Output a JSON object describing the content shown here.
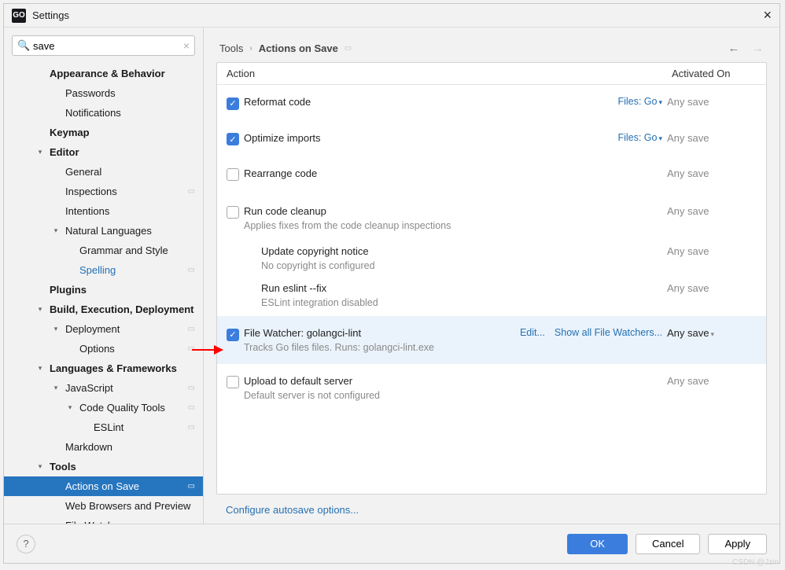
{
  "title": "Settings",
  "app_icon_text": "GO",
  "search": {
    "value": "save"
  },
  "sidebar": {
    "items": [
      {
        "label": "Appearance & Behavior",
        "level": 1,
        "bold": true,
        "chev": ""
      },
      {
        "label": "Passwords",
        "level": 2
      },
      {
        "label": "Notifications",
        "level": 2
      },
      {
        "label": "Keymap",
        "level": 1,
        "bold": true
      },
      {
        "label": "Editor",
        "level": 1,
        "bold": true,
        "chev": "▾"
      },
      {
        "label": "General",
        "level": 2
      },
      {
        "label": "Inspections",
        "level": 2,
        "gear": true
      },
      {
        "label": "Intentions",
        "level": 2
      },
      {
        "label": "Natural Languages",
        "level": 2,
        "chev": "▾"
      },
      {
        "label": "Grammar and Style",
        "level": 3
      },
      {
        "label": "Spelling",
        "level": 3,
        "link": true,
        "gear": true
      },
      {
        "label": "Plugins",
        "level": 1,
        "bold": true
      },
      {
        "label": "Build, Execution, Deployment",
        "level": 1,
        "bold": true,
        "chev": "▾"
      },
      {
        "label": "Deployment",
        "level": 2,
        "chev": "▾",
        "gear": true
      },
      {
        "label": "Options",
        "level": 3,
        "gear": true
      },
      {
        "label": "Languages & Frameworks",
        "level": 1,
        "bold": true,
        "chev": "▾"
      },
      {
        "label": "JavaScript",
        "level": 2,
        "chev": "▾",
        "gear": true
      },
      {
        "label": "Code Quality Tools",
        "level": 3,
        "chev": "▾",
        "gear": true
      },
      {
        "label": "ESLint",
        "level": 4,
        "gear": true
      },
      {
        "label": "Markdown",
        "level": 2
      },
      {
        "label": "Tools",
        "level": 1,
        "bold": true,
        "chev": "▾"
      },
      {
        "label": "Actions on Save",
        "level": 2,
        "selected": true,
        "gear": true
      },
      {
        "label": "Web Browsers and Preview",
        "level": 2
      },
      {
        "label": "File Watchers",
        "level": 2,
        "gear": true
      }
    ]
  },
  "breadcrumb": {
    "parent": "Tools",
    "current": "Actions on Save"
  },
  "columns": {
    "action": "Action",
    "activated": "Activated On"
  },
  "actions": [
    {
      "checked": true,
      "title": "Reformat code",
      "link": "Files: Go",
      "linkCaret": true,
      "activated": "Any save"
    },
    {
      "checked": true,
      "title": "Optimize imports",
      "link": "Files: Go",
      "linkCaret": true,
      "activated": "Any save"
    },
    {
      "checked": false,
      "title": "Rearrange code",
      "activated": "Any save"
    },
    {
      "checked": false,
      "title": "Run code cleanup",
      "sub": "Applies fixes from the code cleanup inspections",
      "activated": "Any save",
      "subs": [
        {
          "title": "Update copyright notice",
          "sub": "No copyright is configured",
          "activated": "Any save"
        },
        {
          "title": "Run eslint --fix",
          "sub": "ESLint integration disabled",
          "activated": "Any save"
        }
      ]
    },
    {
      "checked": true,
      "title": "File Watcher: golangci-lint",
      "sub": "Tracks Go files files. Runs: golangci-lint.exe",
      "selected": true,
      "edit": "Edit...",
      "showAll": "Show all File Watchers...",
      "activated": "Any save",
      "activatedCaret": true
    },
    {
      "checked": false,
      "title": "Upload to default server",
      "sub": "Default server is not configured",
      "activated": "Any save"
    }
  ],
  "configure_autosave": "Configure autosave options...",
  "buttons": {
    "ok": "OK",
    "cancel": "Cancel",
    "apply": "Apply"
  },
  "watermark": "CSDN @Jzin"
}
